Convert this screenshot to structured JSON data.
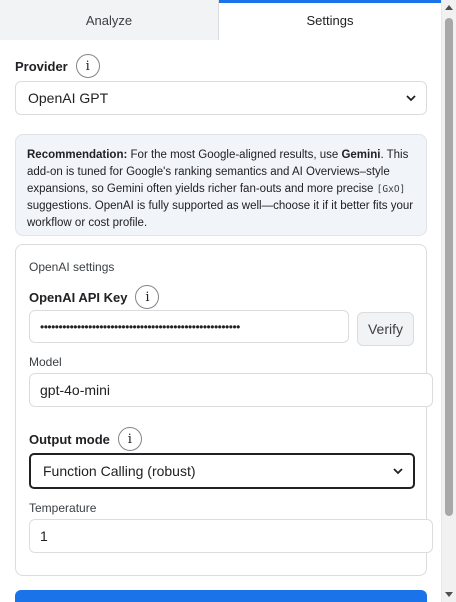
{
  "tabs": [
    {
      "label": "Analyze",
      "active": false
    },
    {
      "label": "Settings",
      "active": true
    }
  ],
  "provider": {
    "label": "Provider",
    "info_icon": "i",
    "selected": "OpenAI GPT"
  },
  "recommendation": {
    "lead": "Recommendation:",
    "text1": " For the most Google-aligned results, use ",
    "emph": "Gemini",
    "text2": ". This add-on is tuned for Google's ranking semantics and AI Overviews–style expansions, so Gemini often yields richer fan-outs and more precise ",
    "code": "[GxO]",
    "text3": " suggestions. OpenAI is fully supported as well—choose it if it better fits your workflow or cost profile."
  },
  "openai_settings": {
    "section_title": "OpenAI settings",
    "api_key_label": "OpenAI API Key",
    "api_key_info_icon": "i",
    "api_key_value": "••••••••••••••••••••••••••••••••••••••••••••••••••••••",
    "verify_label": "Verify",
    "model_label": "Model",
    "model_value": "gpt-4o-mini",
    "output_mode_label": "Output mode",
    "output_mode_info_icon": "i",
    "output_mode_selected": "Function Calling (robust)",
    "temperature_label": "Temperature",
    "temperature_value": "1"
  },
  "colors": {
    "accent": "#1a73e8",
    "panel_bg": "#f1f4f8"
  }
}
